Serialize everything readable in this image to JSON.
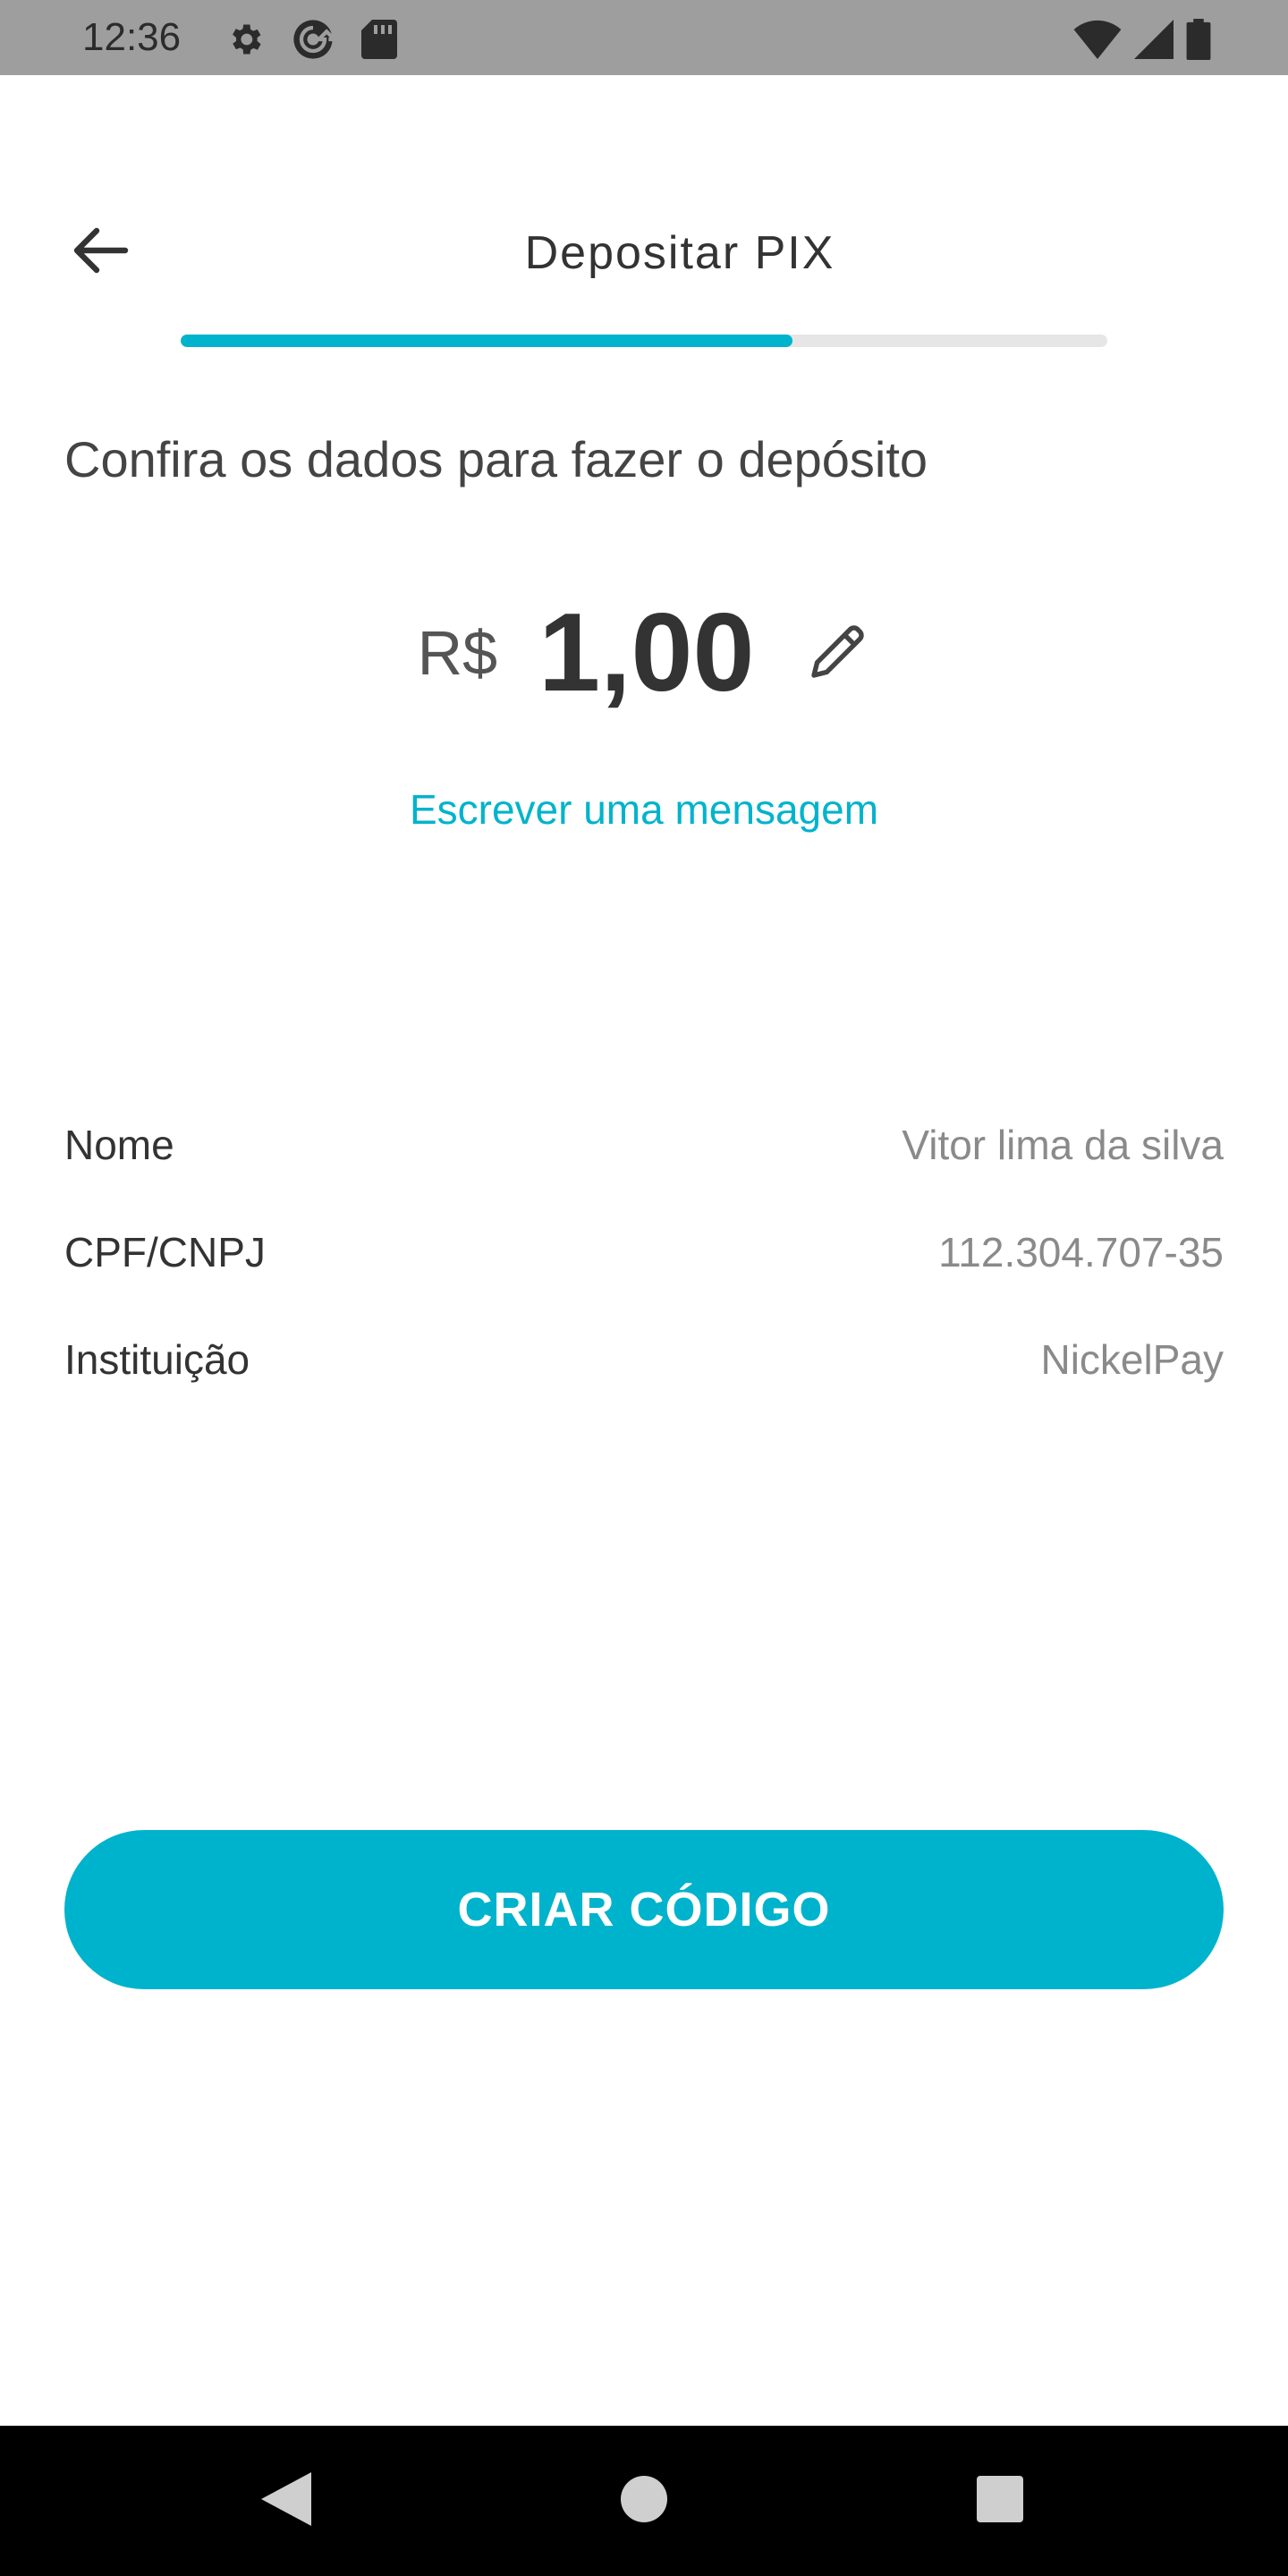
{
  "status_bar": {
    "time": "12:36",
    "left_icons": [
      "gear-icon",
      "sync-icon",
      "sd-card-icon"
    ],
    "right_icons": [
      "wifi-icon",
      "signal-icon",
      "battery-icon"
    ]
  },
  "header": {
    "back_icon": "arrow-left-icon",
    "title": "Depositar PIX"
  },
  "progress": {
    "fraction": 0.66,
    "color": "#00b3cc"
  },
  "content": {
    "subtitle": "Confira os dados para fazer o depósito",
    "currency": "R$",
    "amount": "1,00",
    "edit_icon": "pencil-icon",
    "message_link": "Escrever uma mensagem"
  },
  "details": [
    {
      "label": "Nome",
      "value": "Vitor lima da silva"
    },
    {
      "label": "CPF/CNPJ",
      "value": "112.304.707-35"
    },
    {
      "label": "Instituição",
      "value": "NickelPay"
    }
  ],
  "actions": {
    "primary_label": "CRIAR CÓDIGO",
    "primary_color": "#00b3cc"
  },
  "nav_bar": {
    "buttons": [
      "back-triangle-icon",
      "home-circle-icon",
      "recents-square-icon"
    ]
  }
}
